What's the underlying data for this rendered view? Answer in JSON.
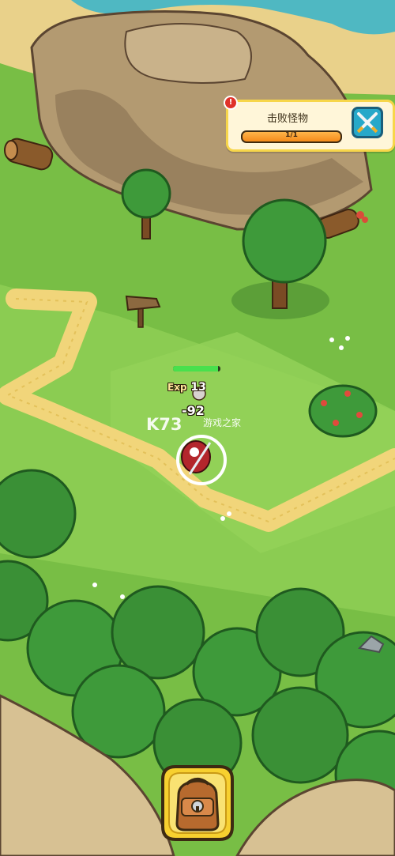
{
  "quest": {
    "title": "击败怪物",
    "progress_text": "1/1",
    "progress_fraction": 1.0,
    "alert_icon": "exclamation-icon",
    "action_icon": "crossed-swords-icon"
  },
  "player": {
    "hp_fraction": 0.95,
    "exp_label": "Exp",
    "exp_value": "13",
    "damage_popup": "-92"
  },
  "watermark": {
    "logo": "K73",
    "subtitle": "游戏之家"
  },
  "bottom": {
    "bag_icon": "backpack-icon"
  },
  "colors": {
    "grass": "#7cc24a",
    "path": "#f1d57a",
    "quest_border": "#f7d64a",
    "action_button": "#27a8c9",
    "hp": "#48e04d",
    "bag_button": "#f7d02f"
  }
}
